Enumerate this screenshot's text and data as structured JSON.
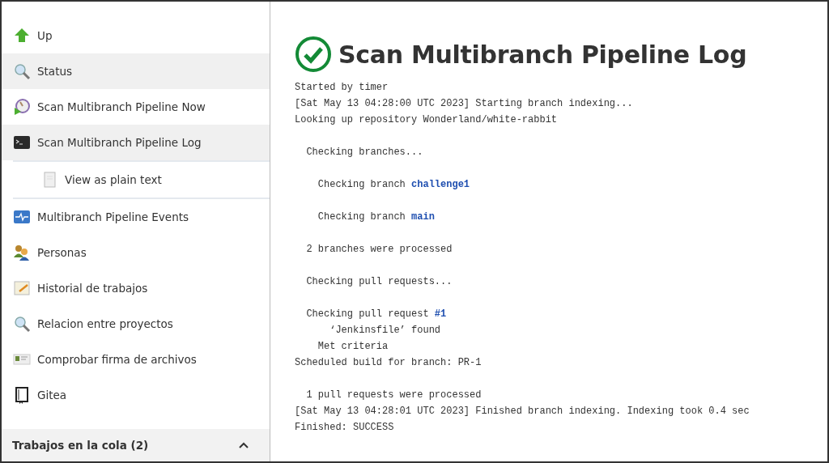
{
  "sidebar": {
    "items": [
      {
        "label": "Up",
        "selected": false
      },
      {
        "label": "Status",
        "selected": true
      },
      {
        "label": "Scan Multibranch Pipeline Now",
        "selected": false
      },
      {
        "label": "Scan Multibranch Pipeline Log",
        "selected": true,
        "children": [
          {
            "label": "View as plain text",
            "selected": false
          }
        ]
      },
      {
        "label": "Multibranch Pipeline Events",
        "selected": false
      },
      {
        "label": "Personas",
        "selected": false
      },
      {
        "label": "Historial de trabajos",
        "selected": false
      },
      {
        "label": "Relacion entre proyectos",
        "selected": false
      },
      {
        "label": "Comprobar firma de archivos",
        "selected": false
      },
      {
        "label": "Gitea",
        "selected": false
      }
    ],
    "queue": {
      "title": "Trabajos en la cola (2)",
      "expanded": true
    }
  },
  "main": {
    "title": "Scan Multibranch Pipeline Log",
    "log": [
      {
        "kind": "text",
        "text": "Started by timer"
      },
      {
        "kind": "text",
        "text": "[Sat May 13 04:28:00 UTC 2023] Starting branch indexing..."
      },
      {
        "kind": "text",
        "text": "Looking up repository Wonderland/white-rabbit"
      },
      {
        "kind": "blank"
      },
      {
        "kind": "text",
        "text": "  Checking branches..."
      },
      {
        "kind": "blank"
      },
      {
        "kind": "text",
        "text": "    Checking branch ",
        "link": "challenge1"
      },
      {
        "kind": "blank"
      },
      {
        "kind": "text",
        "text": "    Checking branch ",
        "link": "main"
      },
      {
        "kind": "blank"
      },
      {
        "kind": "text",
        "text": "  2 branches were processed"
      },
      {
        "kind": "blank"
      },
      {
        "kind": "text",
        "text": "  Checking pull requests..."
      },
      {
        "kind": "blank"
      },
      {
        "kind": "text",
        "text": "  Checking pull request ",
        "link": "#1"
      },
      {
        "kind": "text",
        "text": "      ‘Jenkinsfile’ found"
      },
      {
        "kind": "text",
        "text": "    Met criteria"
      },
      {
        "kind": "text",
        "text": "Scheduled build for branch: PR-1"
      },
      {
        "kind": "blank"
      },
      {
        "kind": "text",
        "text": "  1 pull requests were processed"
      },
      {
        "kind": "text",
        "text": "[Sat May 13 04:28:01 UTC 2023] Finished branch indexing. Indexing took 0.4 sec"
      },
      {
        "kind": "text",
        "text": "Finished: SUCCESS"
      }
    ]
  }
}
